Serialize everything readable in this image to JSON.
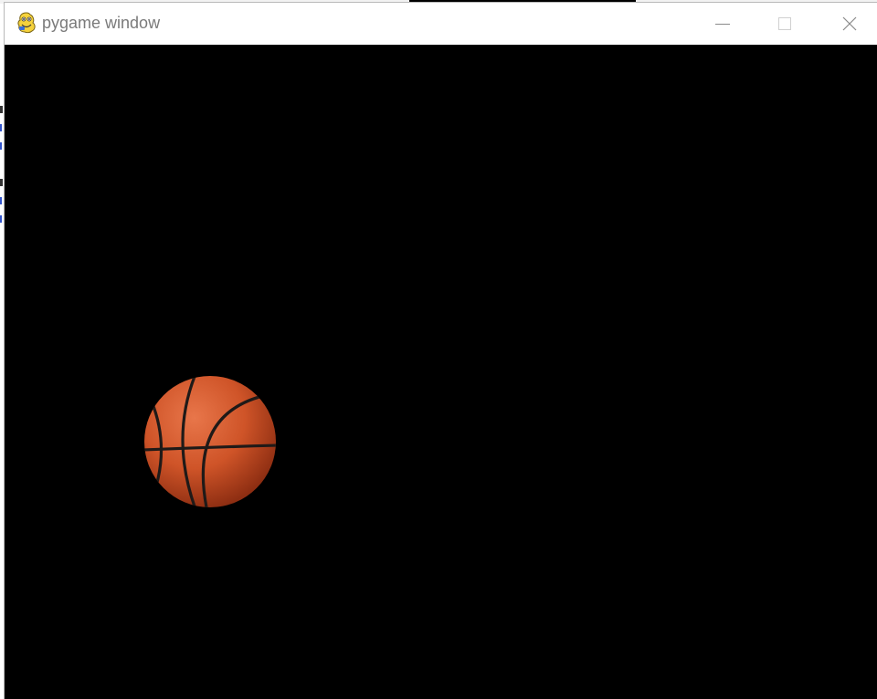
{
  "window": {
    "title": "pygame window",
    "icons": {
      "app": "pygame-snake-icon",
      "minimize": "minimize-icon",
      "maximize": "maximize-icon",
      "close": "close-icon"
    }
  },
  "canvas": {
    "background": "#000000",
    "sprite": {
      "name": "basketball",
      "color": "#d2552a"
    }
  }
}
